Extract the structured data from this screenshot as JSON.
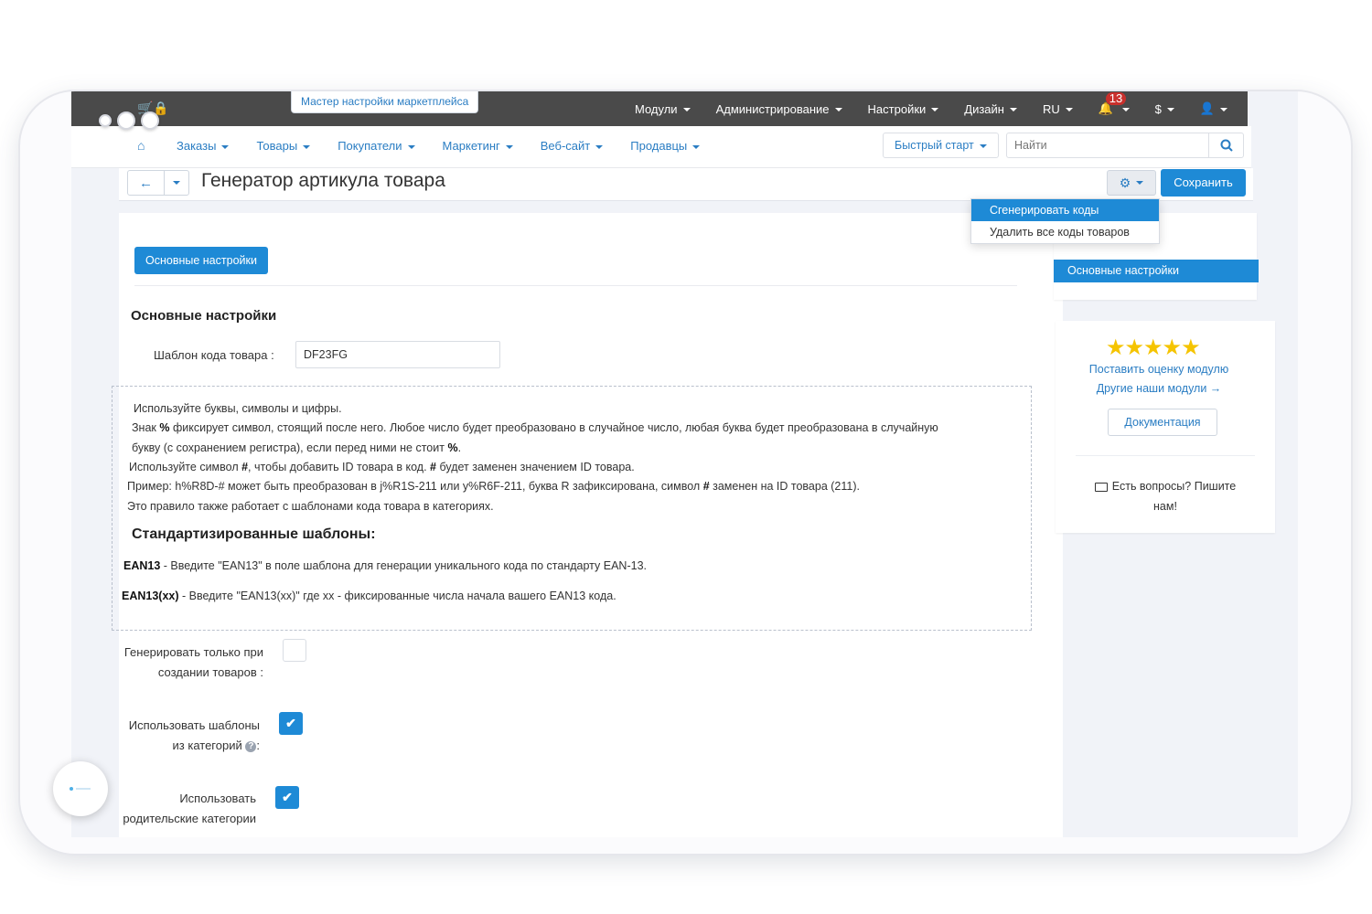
{
  "topbar": {
    "wizard_tab": "Мастер настройки маркетплейса",
    "nav": [
      {
        "label": "Модули"
      },
      {
        "label": "Администрирование"
      },
      {
        "label": "Настройки"
      },
      {
        "label": "Дизайн"
      },
      {
        "label": "RU"
      }
    ],
    "notifications_count": "13",
    "currency": "$"
  },
  "menubar": {
    "items": [
      {
        "label": "Заказы"
      },
      {
        "label": "Товары"
      },
      {
        "label": "Покупатели"
      },
      {
        "label": "Маркетинг"
      },
      {
        "label": "Веб-сайт"
      },
      {
        "label": "Продавцы"
      }
    ],
    "quick_start": "Быстрый старт",
    "search_placeholder": "Найти"
  },
  "titlebar": {
    "title": "Генератор артикула товара",
    "save": "Сохранить"
  },
  "dropdown": {
    "items": [
      {
        "label": "Сгенерировать коды"
      },
      {
        "label": "Удалить все коды товаров"
      }
    ]
  },
  "main": {
    "tab": "Основные настройки",
    "section_title": "Основные настройки",
    "code_template_label": "Шаблон кода товара :",
    "code_template_value": "DF23FG",
    "help": {
      "line1": "Используйте буквы, символы и цифры.",
      "line2_a": "Знак ",
      "line2_b": "%",
      "line2_c": " фиксирует символ, стоящий после него. Любое число будет преобразовано в случайное число, любая буква будет преобразована в случайную",
      "line3_a": "букву (с сохранением регистра), если перед ними не стоит ",
      "line3_b": "%",
      "line3_c": ".",
      "line4_a": "Используйте символ ",
      "line4_b": "#",
      "line4_c": ", чтобы добавить ID товара в код. ",
      "line4_d": "#",
      "line4_e": " будет заменен значением ID товара.",
      "line5_a": "Пример: h%R8D-# может быть преобразован в j%R1S-211 или y%R6F-211, буква R зафиксирована, символ ",
      "line5_b": "#",
      "line5_c": " заменен на ID товара (211).",
      "line6": "Это правило также работает с шаблонами кода товара в категориях.",
      "std_title": "Стандартизированные шаблоны:",
      "ean13_b": "EAN13",
      "ean13_text": " - Введите \"EAN13\" в поле шаблона для генерации уникального кода по стандарту EAN-13.",
      "ean13xx_b": "EAN13(xx)",
      "ean13xx_text": " - Введите \"EAN13(xx)\" где хх - фиксированные числа начала вашего EAN13 кода."
    },
    "opt1_line1": "Генерировать только при",
    "opt1_line2": "создании товаров :",
    "opt1_checked": false,
    "opt2_line1": "Использовать шаблоны",
    "opt2_line2": "из категорий",
    "opt2_suffix": ":",
    "opt2_checked": true,
    "opt3_line1": "Использовать",
    "opt3_line2": "родительские категории",
    "opt3_checked": true
  },
  "sidebar": {
    "active_item": "Основные настройки",
    "rating": 5,
    "rate_link": "Поставить оценку модулю",
    "other_modules": "Другие наши модули →",
    "docs": "Документация",
    "questions_line1": "Есть вопросы? Пишите",
    "questions_line2": "нам!"
  },
  "colors": {
    "accent": "#1e8ad6",
    "topbar": "#4a4a4a",
    "link": "#2a7dc3",
    "star": "#f5c400",
    "badge": "#c9302c"
  }
}
